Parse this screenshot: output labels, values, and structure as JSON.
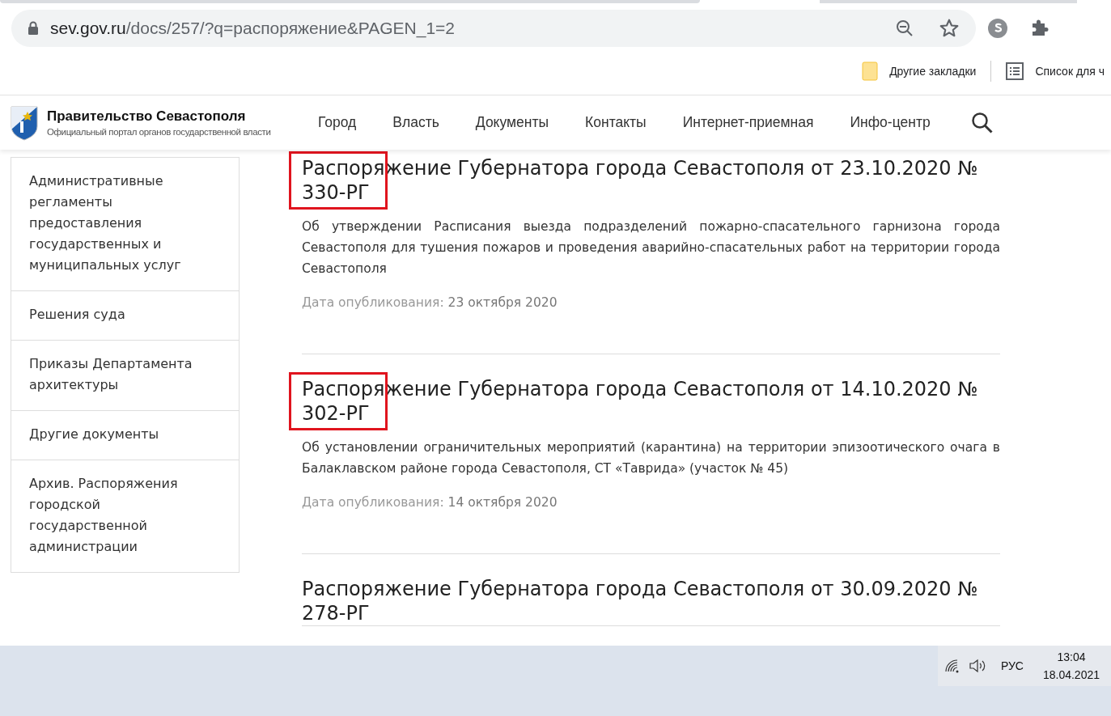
{
  "browser": {
    "url_host": "sev.gov.ru",
    "url_path": "/docs/257/?q=распоряжение&PAGEN_1=2",
    "bookmarks": [
      {
        "kind": "folder",
        "label": "Другие закладки"
      },
      {
        "kind": "list",
        "label": "Список для ч"
      }
    ]
  },
  "site": {
    "title": "Правительство Севастополя",
    "subtitle": "Официальный портал органов государственной власти",
    "nav": [
      "Город",
      "Власть",
      "Документы",
      "Контакты",
      "Интернет-приемная",
      "Инфо-центр"
    ]
  },
  "sidebar": {
    "items": [
      "Административные регламенты предоставления государственных и муниципальных услуг",
      "Решения суда",
      "Приказы Департамента архитектуры",
      "Другие документы",
      "Архив. Распоряжения городской государственной администрации"
    ]
  },
  "documents": [
    {
      "title": "Распоряжение Губернатора города Севастополя от 23.10.2020 № 330-РГ",
      "highlighted": true,
      "description": "Об утверждении Расписания выезда подразделений пожарно-спасательного гарнизона города Севастополя для тушения пожаров и проведения аварийно-спасательных работ на территории города Севастополя",
      "date_label": "Дата опубликования:",
      "date": "23 октября 2020"
    },
    {
      "title": "Распоряжение Губернатора города Севастополя от 14.10.2020 № 302-РГ",
      "highlighted": true,
      "description": "Об установлении ограничительных мероприятий (карантина) на территории эпизоотического очага в Балаклавском районе города Севастополя, СТ «Таврида» (участок № 45)",
      "date_label": "Дата опубликования:",
      "date": "14 октября 2020"
    },
    {
      "title": "Распоряжение Губернатора города Севастополя от 30.09.2020 № 278-РГ",
      "highlighted": false
    }
  ],
  "taskbar": {
    "language": "РУС",
    "time": "13:04",
    "date": "18.04.2021"
  }
}
